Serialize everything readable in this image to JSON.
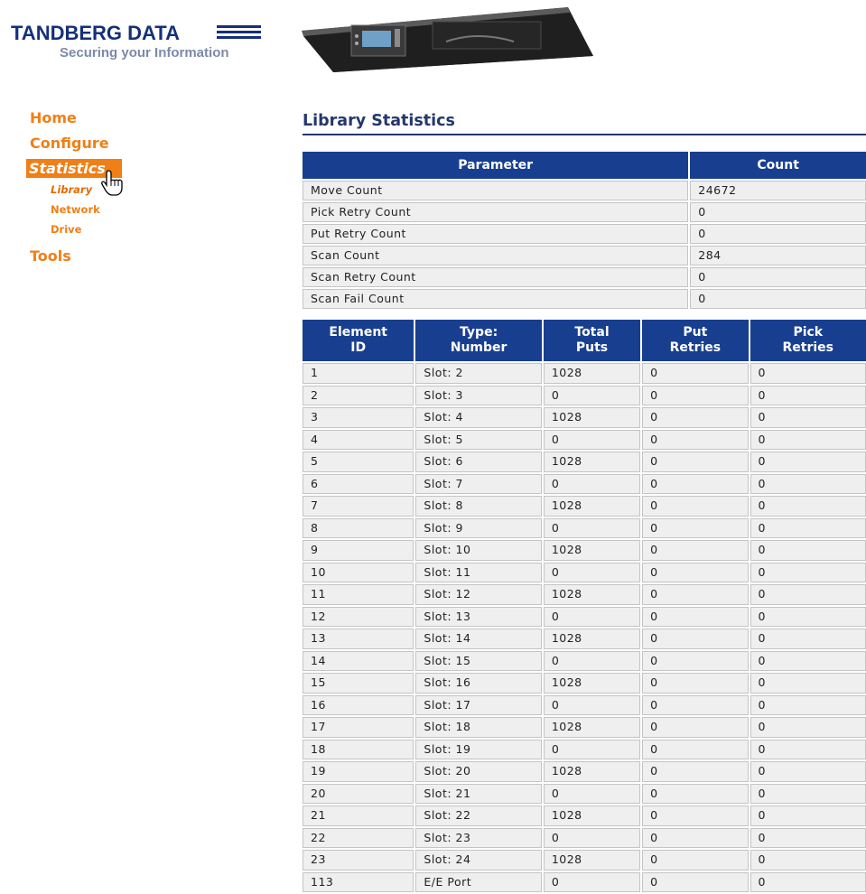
{
  "branding": {
    "logo_name": "TANDBERG DATA",
    "tagline": "Securing your Information",
    "brand_color": "#14307a",
    "accent_color": "#f07f16"
  },
  "nav": {
    "home": "Home",
    "configure": "Configure",
    "statistics": "Statistics",
    "library": "Library",
    "network": "Network",
    "drive": "Drive",
    "tools": "Tools",
    "pointer_icon": "hand-pointer-icon"
  },
  "page": {
    "title": "Library Statistics"
  },
  "params_table": {
    "headers": [
      "Parameter",
      "Count"
    ],
    "rows": [
      [
        "Move Count",
        "24672"
      ],
      [
        "Pick Retry Count",
        "0"
      ],
      [
        "Put Retry Count",
        "0"
      ],
      [
        "Scan Count",
        "284"
      ],
      [
        "Scan Retry Count",
        "0"
      ],
      [
        "Scan Fail Count",
        "0"
      ]
    ]
  },
  "elements_table": {
    "headers": [
      [
        "Element",
        "ID"
      ],
      [
        "Type:",
        "Number"
      ],
      [
        "Total",
        "Puts"
      ],
      [
        "Put",
        "Retries"
      ],
      [
        "Pick",
        "Retries"
      ]
    ],
    "rows": [
      [
        "1",
        "Slot: 2",
        "1028",
        "0",
        "0"
      ],
      [
        "2",
        "Slot: 3",
        "0",
        "0",
        "0"
      ],
      [
        "3",
        "Slot: 4",
        "1028",
        "0",
        "0"
      ],
      [
        "4",
        "Slot: 5",
        "0",
        "0",
        "0"
      ],
      [
        "5",
        "Slot: 6",
        "1028",
        "0",
        "0"
      ],
      [
        "6",
        "Slot: 7",
        "0",
        "0",
        "0"
      ],
      [
        "7",
        "Slot: 8",
        "1028",
        "0",
        "0"
      ],
      [
        "8",
        "Slot: 9",
        "0",
        "0",
        "0"
      ],
      [
        "9",
        "Slot: 10",
        "1028",
        "0",
        "0"
      ],
      [
        "10",
        "Slot: 11",
        "0",
        "0",
        "0"
      ],
      [
        "11",
        "Slot: 12",
        "1028",
        "0",
        "0"
      ],
      [
        "12",
        "Slot: 13",
        "0",
        "0",
        "0"
      ],
      [
        "13",
        "Slot: 14",
        "1028",
        "0",
        "0"
      ],
      [
        "14",
        "Slot: 15",
        "0",
        "0",
        "0"
      ],
      [
        "15",
        "Slot: 16",
        "1028",
        "0",
        "0"
      ],
      [
        "16",
        "Slot: 17",
        "0",
        "0",
        "0"
      ],
      [
        "17",
        "Slot: 18",
        "1028",
        "0",
        "0"
      ],
      [
        "18",
        "Slot: 19",
        "0",
        "0",
        "0"
      ],
      [
        "19",
        "Slot: 20",
        "1028",
        "0",
        "0"
      ],
      [
        "20",
        "Slot: 21",
        "0",
        "0",
        "0"
      ],
      [
        "21",
        "Slot: 22",
        "1028",
        "0",
        "0"
      ],
      [
        "22",
        "Slot: 23",
        "0",
        "0",
        "0"
      ],
      [
        "23",
        "Slot: 24",
        "1028",
        "0",
        "0"
      ],
      [
        "113",
        "E/E Port",
        "0",
        "0",
        "0"
      ]
    ]
  }
}
